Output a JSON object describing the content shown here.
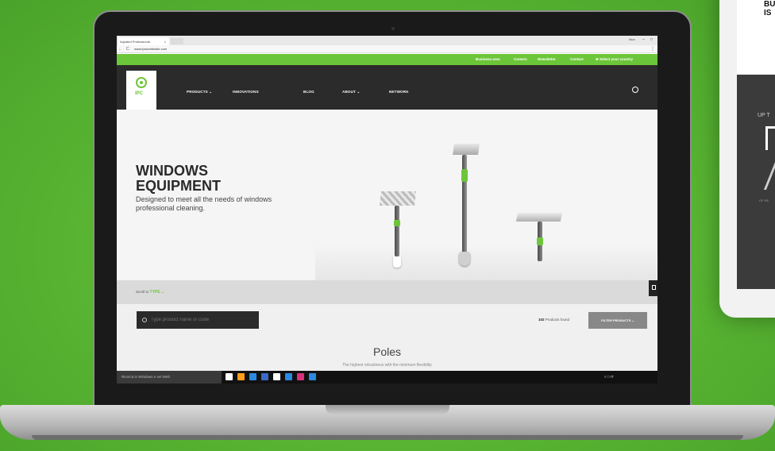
{
  "tablet": {
    "headline": "BU\nIS",
    "upto": "UP T",
    "small": "OF RE"
  },
  "browser": {
    "tab_title": "Ingrated Professional",
    "tab_close": "x",
    "user": "Idoo",
    "window_min": "–",
    "window_max": "□",
    "nav_back": "←",
    "reload": "C",
    "url": "www.ipcworldwide.com"
  },
  "site": {
    "logo_text": "IPC",
    "top_links": [
      "Business area",
      "Careers",
      "Newsletter",
      "Contact",
      "Select your country"
    ],
    "nav_items": [
      "PRODUCTS",
      "INNOVATIONS",
      "BLOG",
      "ABOUT",
      "NETWORK"
    ],
    "hero_title": "WINDOWS EQUIPMENT",
    "hero_subtitle": "Designed to meet all the needs of windows professional cleaning.",
    "scroll_to_label": "Scroll to",
    "scroll_to_value": "TYPE",
    "search_placeholder": "Type product name or code",
    "products_count": "102",
    "products_found_label": "Products found",
    "filter_button": "FILTER PRODUCTS",
    "category_title": "Poles",
    "category_subtitle": "The highest robustness with the minimum flexibility"
  },
  "taskbar": {
    "search_text": "Ricerca in Windows e nel Web",
    "tray_text": "˄ □ IT",
    "icon_colors": [
      "#ffffff",
      "#ff9f1c",
      "#2b8ae0",
      "#3a6bc4",
      "#ffffff",
      "#2b8ae0",
      "#d6337a",
      "#2b8ae0"
    ]
  },
  "colors": {
    "brand_green": "#6cc639",
    "nav_dark": "#2b2b2b"
  }
}
